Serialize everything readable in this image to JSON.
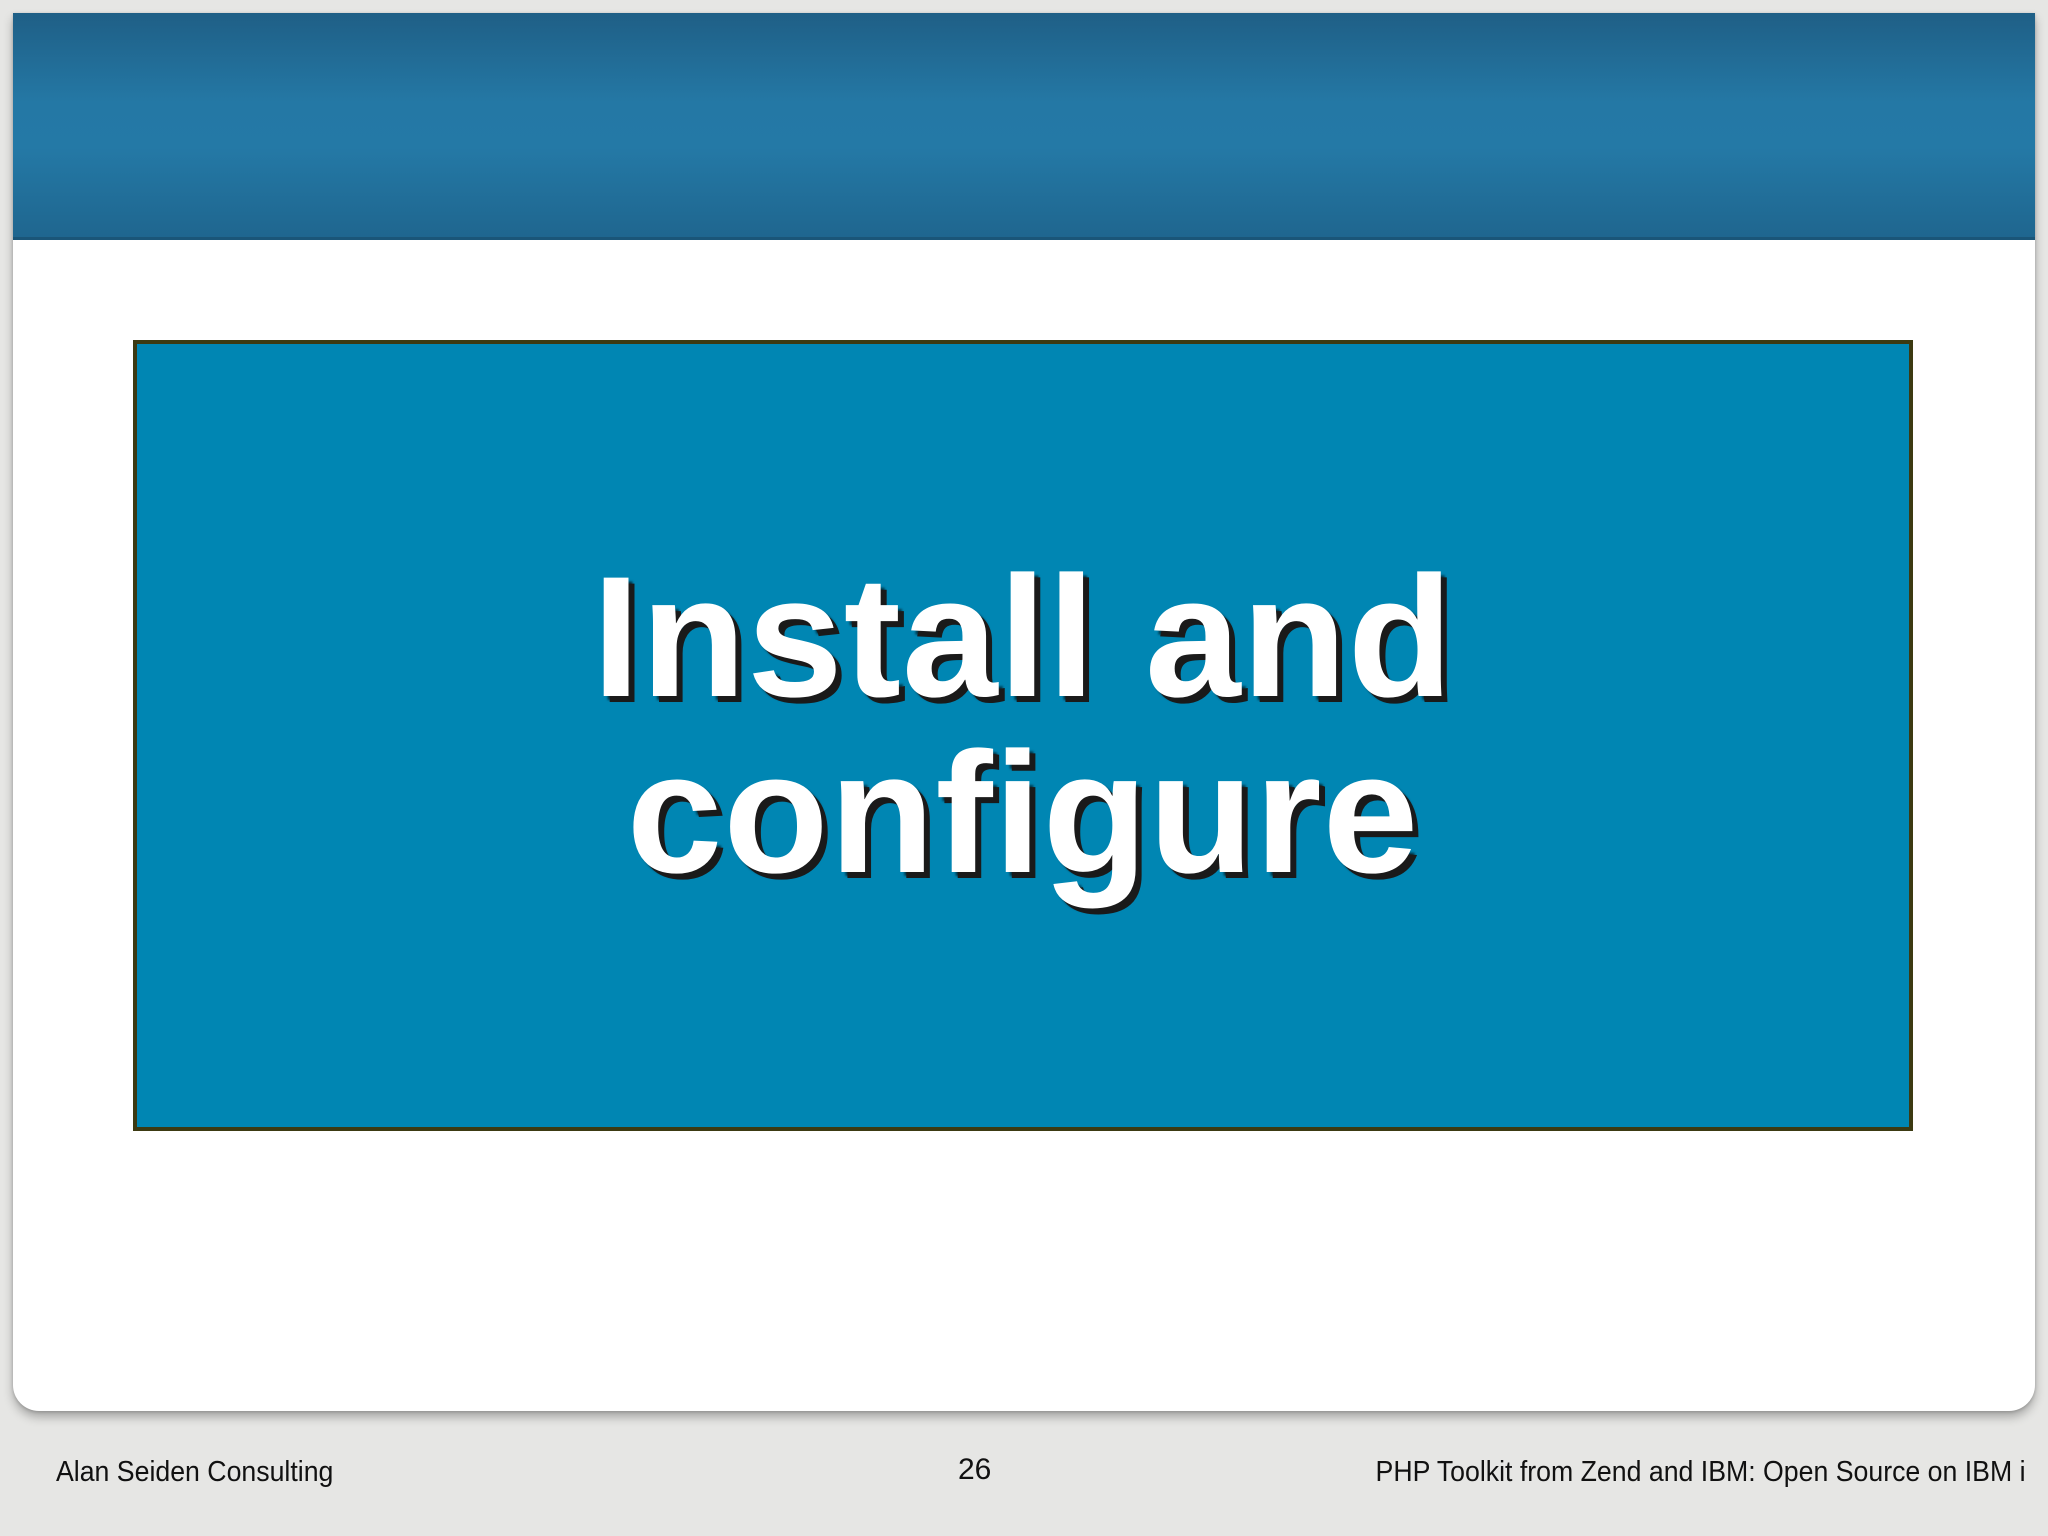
{
  "slide": {
    "title_lines": [
      "Install and",
      "configure"
    ]
  },
  "footer": {
    "left": "Alan Seiden Consulting",
    "page_number": "26",
    "right": "PHP Toolkit from Zend and IBM: Open Source on IBM i"
  },
  "colors": {
    "header": "#2478a5",
    "title_box": "#0086b3",
    "title_box_border": "#3c3a12",
    "title_text": "#ffffff",
    "background": "#e6e6e4"
  }
}
